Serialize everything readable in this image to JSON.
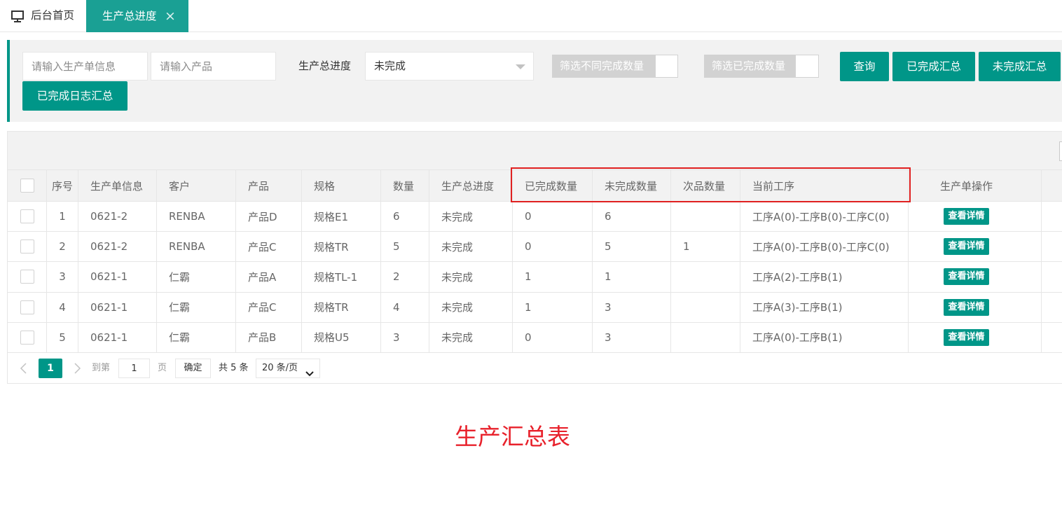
{
  "tabs": {
    "home_label": "后台首页",
    "home_icon": "monitor-icon",
    "active_label": "生产总进度",
    "close_icon": "close-icon",
    "close_symbol": "×"
  },
  "filters": {
    "order_info_placeholder": "请输入生产单信息",
    "product_placeholder": "请输入产品",
    "progress_label": "生产总进度",
    "progress_value": "未完成",
    "dropdown_icon": "triangle-down-icon",
    "toggle_diff_label": "筛选不同完成数量",
    "toggle_diff_on": false,
    "toggle_done_label": "筛选已完成数量",
    "toggle_done_on": false,
    "query_label": "查询",
    "done_summary_label": "已完成汇总",
    "undone_summary_label": "未完成汇总",
    "done_log_summary_label": "已完成日志汇总"
  },
  "table": {
    "columns": [
      "序号",
      "生产单信息",
      "客户",
      "产品",
      "规格",
      "数量",
      "生产总进度",
      "已完成数量",
      "未完成数量",
      "次品数量",
      "当前工序",
      "生产单操作"
    ],
    "rows": [
      [
        "1",
        "0621-2",
        "RENBA",
        "产品D",
        "规格E1",
        "6",
        "未完成",
        "0",
        "6",
        "",
        "工序A(0)-工序B(0)-工序C(0)"
      ],
      [
        "2",
        "0621-2",
        "RENBA",
        "产品C",
        "规格TR",
        "5",
        "未完成",
        "0",
        "5",
        "1",
        "工序A(0)-工序B(0)-工序C(0)"
      ],
      [
        "3",
        "0621-1",
        "仁霸",
        "产品A",
        "规格TL-1",
        "2",
        "未完成",
        "1",
        "1",
        "",
        "工序A(2)-工序B(1)"
      ],
      [
        "4",
        "0621-1",
        "仁霸",
        "产品C",
        "规格TR",
        "4",
        "未完成",
        "1",
        "3",
        "",
        "工序A(3)-工序B(1)"
      ],
      [
        "5",
        "0621-1",
        "仁霸",
        "产品B",
        "规格U5",
        "3",
        "未完成",
        "0",
        "3",
        "",
        "工序A(0)-工序B(1)"
      ]
    ],
    "action_label": "查看详情"
  },
  "pagination": {
    "prev_icon": "chevron-left-icon",
    "current_page": "1",
    "next_icon": "chevron-right-icon",
    "goto_label": "到第",
    "goto_value": "1",
    "page_unit": "页",
    "confirm_label": "确定",
    "total_label": "共 5 条",
    "page_size": "20 条/页",
    "page_size_icon": "chevron-down-icon"
  },
  "caption": "生产汇总表",
  "colors": {
    "accent": "#009688",
    "tab_active": "#1aa094",
    "toggle_off": "#d2d2d2",
    "highlight_border": "#e02020",
    "caption": "#e8212b"
  }
}
